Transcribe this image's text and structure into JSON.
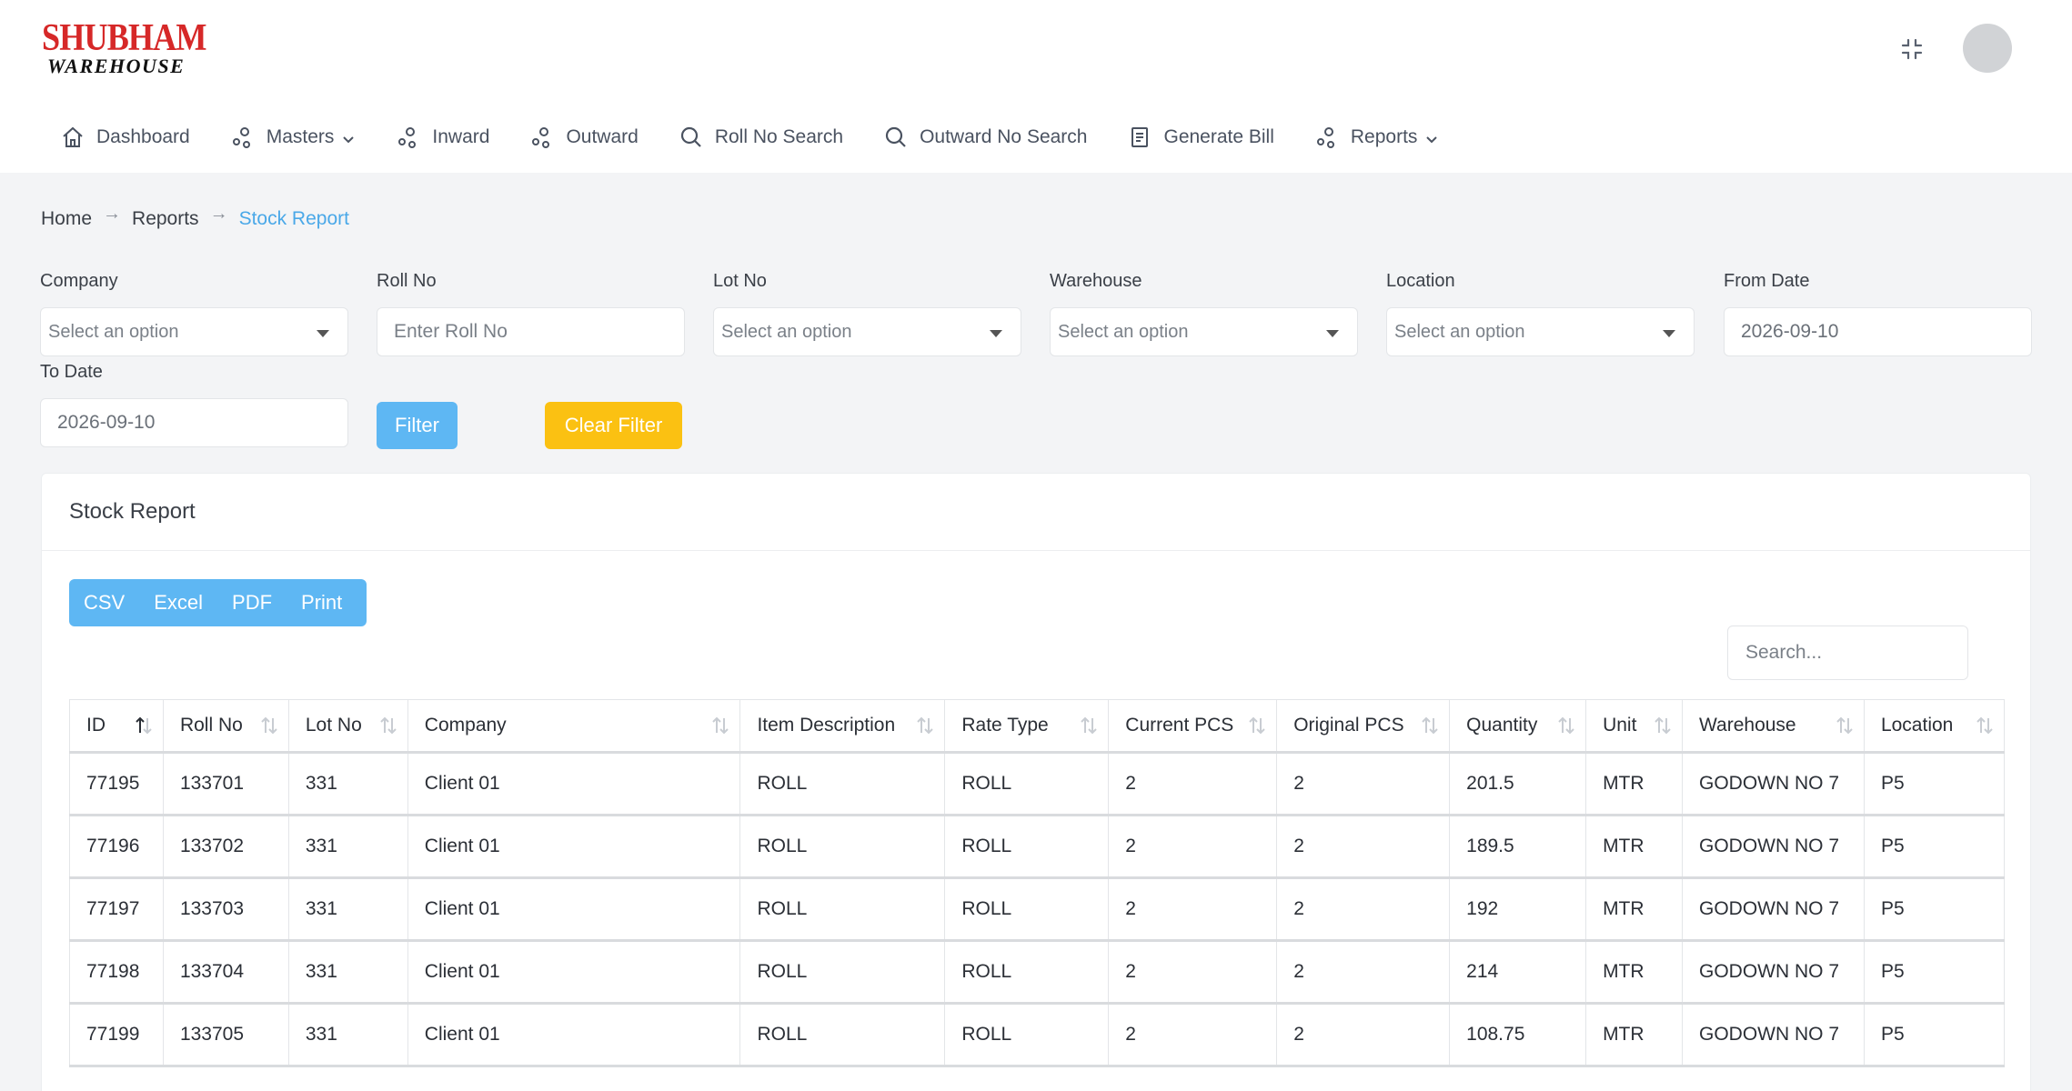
{
  "brand": {
    "line1": "SHUBHAM",
    "line2": "WAREHOUSE",
    "primary_color": "#d62828"
  },
  "nav": [
    {
      "label": "Dashboard",
      "icon": "home-icon",
      "dropdown": false
    },
    {
      "label": "Masters",
      "icon": "nodes-icon",
      "dropdown": true
    },
    {
      "label": "Inward",
      "icon": "nodes-icon",
      "dropdown": false
    },
    {
      "label": "Outward",
      "icon": "nodes-icon",
      "dropdown": false
    },
    {
      "label": "Roll No Search",
      "icon": "search-icon",
      "dropdown": false
    },
    {
      "label": "Outward No Search",
      "icon": "search-icon",
      "dropdown": false
    },
    {
      "label": "Generate Bill",
      "icon": "document-icon",
      "dropdown": false
    },
    {
      "label": "Reports",
      "icon": "nodes-icon",
      "dropdown": true
    }
  ],
  "breadcrumb": {
    "home": "Home",
    "reports": "Reports",
    "current": "Stock Report",
    "separator": "→"
  },
  "filters": {
    "company": {
      "label": "Company",
      "placeholder": "Select an option"
    },
    "roll_no": {
      "label": "Roll No",
      "placeholder": "Enter Roll No"
    },
    "lot_no": {
      "label": "Lot No",
      "placeholder": "Select an option"
    },
    "warehouse": {
      "label": "Warehouse",
      "placeholder": "Select an option"
    },
    "location": {
      "label": "Location",
      "placeholder": "Select an option"
    },
    "from_date": {
      "label": "From Date",
      "value": "2026-09-10"
    },
    "to_date": {
      "label": "To Date",
      "value": "2026-09-10"
    },
    "filter_button": "Filter",
    "clear_button": "Clear Filter"
  },
  "report": {
    "title": "Stock Report",
    "exports": [
      "CSV",
      "Excel",
      "PDF",
      "Print"
    ],
    "search_placeholder": "Search...",
    "columns": [
      "ID",
      "Roll No",
      "Lot No",
      "Company",
      "Item Description",
      "Rate Type",
      "Current PCS",
      "Original PCS",
      "Quantity",
      "Unit",
      "Warehouse",
      "Location"
    ],
    "rows": [
      [
        "77195",
        "133701",
        "331",
        "Client 01",
        "ROLL",
        "ROLL",
        "2",
        "2",
        "201.5",
        "MTR",
        "GODOWN NO 7",
        "P5"
      ],
      [
        "77196",
        "133702",
        "331",
        "Client 01",
        "ROLL",
        "ROLL",
        "2",
        "2",
        "189.5",
        "MTR",
        "GODOWN NO 7",
        "P5"
      ],
      [
        "77197",
        "133703",
        "331",
        "Client 01",
        "ROLL",
        "ROLL",
        "2",
        "2",
        "192",
        "MTR",
        "GODOWN NO 7",
        "P5"
      ],
      [
        "77198",
        "133704",
        "331",
        "Client 01",
        "ROLL",
        "ROLL",
        "2",
        "2",
        "214",
        "MTR",
        "GODOWN NO 7",
        "P5"
      ],
      [
        "77199",
        "133705",
        "331",
        "Client 01",
        "ROLL",
        "ROLL",
        "2",
        "2",
        "108.75",
        "MTR",
        "GODOWN NO 7",
        "P5"
      ]
    ]
  },
  "colors": {
    "accent": "#5eb7f3",
    "warning": "#fbc112",
    "link_active": "#4aa8e8",
    "background": "#f3f4f6"
  }
}
